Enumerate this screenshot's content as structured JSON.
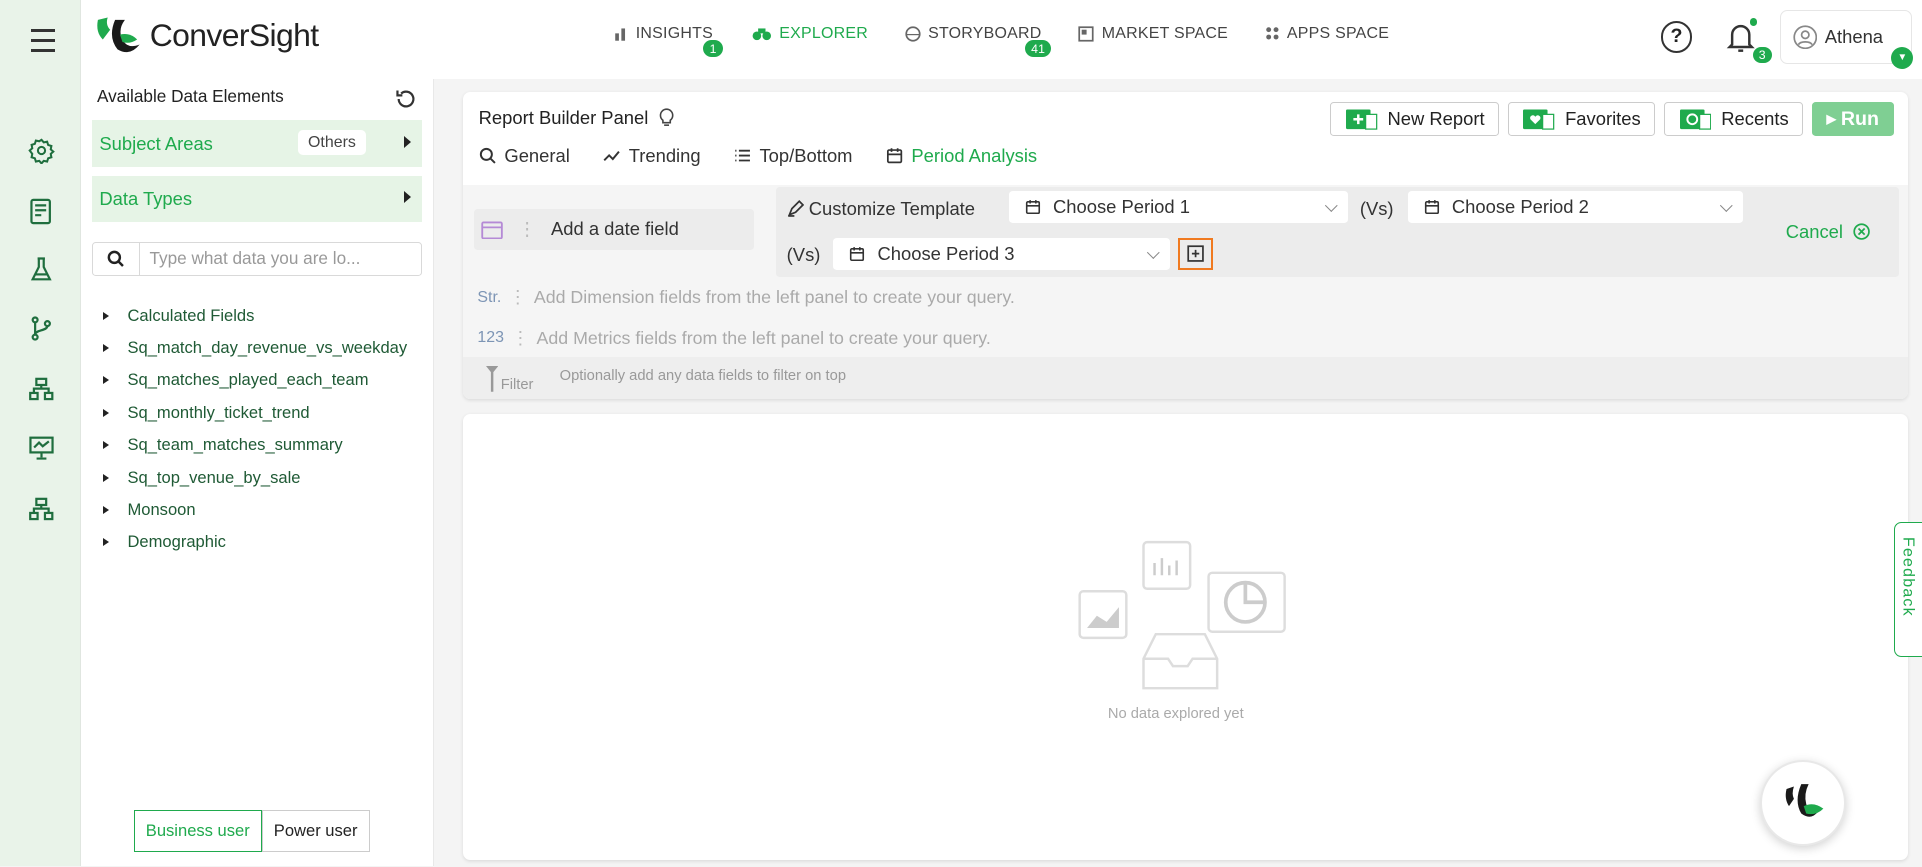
{
  "app": {
    "name": "ConverSight"
  },
  "nav": {
    "tabs": [
      {
        "label": "INSIGHTS",
        "badge": "1"
      },
      {
        "label": "EXPLORER"
      },
      {
        "label": "STORYBOARD",
        "badge": "41"
      },
      {
        "label": "MARKET SPACE"
      },
      {
        "label": "APPS SPACE"
      }
    ],
    "help": "?",
    "notifications_badge": "3",
    "user": "Athena"
  },
  "sidebar": {
    "title": "Available Data Elements",
    "subject_areas": {
      "label": "Subject Areas",
      "pill": "Others"
    },
    "data_types": {
      "label": "Data Types"
    },
    "search_placeholder": "Type what data you are lo...",
    "items": [
      {
        "label": "Calculated Fields"
      },
      {
        "label": "Sq_match_day_revenue_vs_weekday"
      },
      {
        "label": "Sq_matches_played_each_team"
      },
      {
        "label": "Sq_monthly_ticket_trend"
      },
      {
        "label": "Sq_team_matches_summary"
      },
      {
        "label": "Sq_top_venue_by_sale"
      },
      {
        "label": "Monsoon"
      },
      {
        "label": "Demographic"
      }
    ],
    "mode": {
      "business": "Business user",
      "power": "Power user"
    }
  },
  "builder": {
    "title": "Report Builder Panel",
    "buttons": {
      "new_report": "New Report",
      "favorites": "Favorites",
      "recents": "Recents",
      "run": "Run"
    },
    "tabs": [
      {
        "label": "General"
      },
      {
        "label": "Trending"
      },
      {
        "label": "Top/Bottom"
      },
      {
        "label": "Period Analysis"
      }
    ],
    "date_field": "Add a date field",
    "customize": "Customize Template",
    "vs": "(Vs)",
    "periods": [
      "Choose Period 1",
      "Choose Period 2",
      "Choose Period 3"
    ],
    "cancel": "Cancel",
    "dimension_tag": "Str.",
    "dimension_hint": "Add Dimension fields from the left panel to create your query.",
    "metric_tag": "123",
    "metric_hint": "Add Metrics fields from the left panel to create your query.",
    "filter_label": "Filter",
    "filter_hint": "Optionally add any data fields to filter on top"
  },
  "result": {
    "empty_text": "No data explored yet"
  },
  "feedback": "Feedback",
  "colors": {
    "accent": "#1faa4d",
    "highlight": "#f07a20"
  }
}
